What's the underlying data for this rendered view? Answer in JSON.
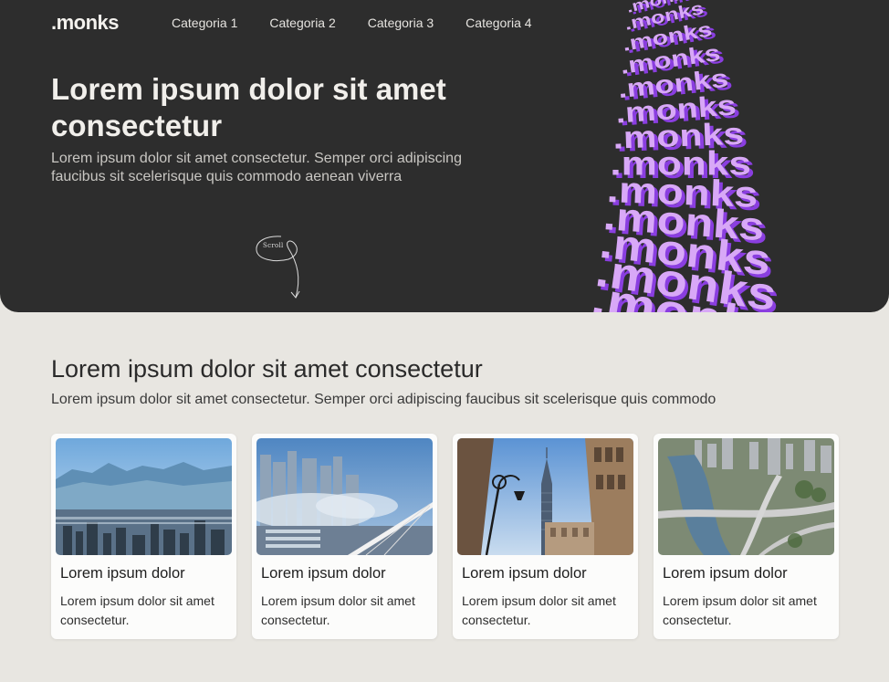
{
  "header": {
    "logo": ".monks",
    "nav": [
      {
        "label": "Categoria 1"
      },
      {
        "label": "Categoria 2"
      },
      {
        "label": "Categoria 3"
      },
      {
        "label": "Categoria 4"
      }
    ]
  },
  "hero": {
    "title": "Lorem ipsum dolor sit amet consectetur",
    "subtitle": "Lorem ipsum dolor sit amet consectetur. Semper orci adipiscing faucibus sit scelerisque quis commodo aenean viverra",
    "scroll_label": "Scroll",
    "art_word": ".monks",
    "accent_light": "#d8a8f7",
    "accent_dark": "#8a3ee0"
  },
  "section": {
    "title": "Lorem ipsum dolor sit amet consectetur",
    "subtitle": "Lorem ipsum dolor sit amet consectetur. Semper orci adipiscing faucibus sit scelerisque quis commodo"
  },
  "cards": [
    {
      "title": "Lorem ipsum dolor",
      "text": "Lorem ipsum dolor sit amet consectetur.",
      "image": "mountain-city-photo"
    },
    {
      "title": "Lorem ipsum dolor",
      "text": "Lorem ipsum dolor sit amet consectetur.",
      "image": "skyline-bridge-photo"
    },
    {
      "title": "Lorem ipsum dolor",
      "text": "Lorem ipsum dolor sit amet consectetur.",
      "image": "tower-streetlamp-photo"
    },
    {
      "title": "Lorem ipsum dolor",
      "text": "Lorem ipsum dolor sit amet consectetur.",
      "image": "river-highway-aerial-photo"
    }
  ],
  "colors": {
    "hero_bg": "#2d2d2d",
    "page_bg": "#e8e6e1",
    "card_bg": "#fcfcfb"
  }
}
